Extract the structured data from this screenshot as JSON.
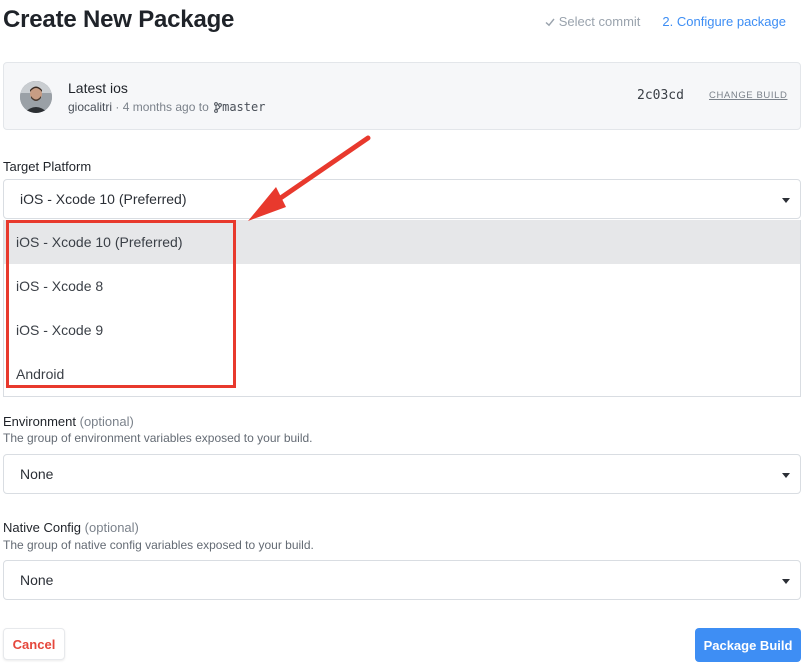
{
  "page": {
    "title": "Create New Package"
  },
  "steps": {
    "select_commit": "Select commit",
    "configure_package": "2. Configure package"
  },
  "build": {
    "title": "Latest ios",
    "author": "giocalitri",
    "separator": " · ",
    "time": "4 months ago to",
    "branch": "master",
    "commit": "2c03cd",
    "change_label": "CHANGE BUILD"
  },
  "target_platform": {
    "label": "Target Platform",
    "selected": "iOS - Xcode 10 (Preferred)",
    "options": [
      "iOS - Xcode 10 (Preferred)",
      "iOS - Xcode 8",
      "iOS - Xcode 9",
      "Android"
    ]
  },
  "environment": {
    "label": "Environment",
    "optional": "(optional)",
    "help": "The group of environment variables exposed to your build.",
    "selected": "None"
  },
  "native_config": {
    "label": "Native Config",
    "optional": "(optional)",
    "help": "The group of native config variables exposed to your build.",
    "selected": "None"
  },
  "actions": {
    "cancel": "Cancel",
    "submit": "Package Build"
  },
  "colors": {
    "accent": "#3e8ef4",
    "danger": "#e5473c",
    "annotation": "#e8392d"
  }
}
